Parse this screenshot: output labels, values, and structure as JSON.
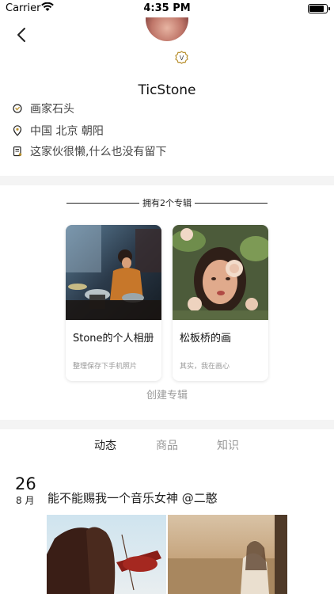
{
  "status_bar": {
    "carrier": "Carrier",
    "time": "4:35 PM",
    "battery_level": 0.9
  },
  "profile": {
    "username": "TicStone",
    "title": "画家石头",
    "location": "中国 北京 朝阳",
    "bio": "这家伙很懒,什么也没有留下",
    "badge_letter": "V"
  },
  "albums": {
    "heading": "拥有2个专辑",
    "items": [
      {
        "title": "Stone的个人相册",
        "description": "整理保存下手机照片"
      },
      {
        "title": "松板桥的画",
        "description": "其实，我在画心"
      }
    ],
    "create_label": "创建专辑"
  },
  "tabs": [
    {
      "label": "动态",
      "active": true
    },
    {
      "label": "商品",
      "active": false
    },
    {
      "label": "知识",
      "active": false
    }
  ],
  "post": {
    "day": "26",
    "month": "8 月",
    "text": "能不能赐我一个音乐女神  @二憨"
  },
  "colors": {
    "accent_gold": "#b8902e",
    "divider": "#f4f4f4",
    "muted_text": "#999999"
  },
  "icons": {
    "back": "chevron-left-icon",
    "badge": "verified-badge-icon",
    "title": "verified-icon",
    "location": "location-pin-icon",
    "bio": "note-icon"
  }
}
